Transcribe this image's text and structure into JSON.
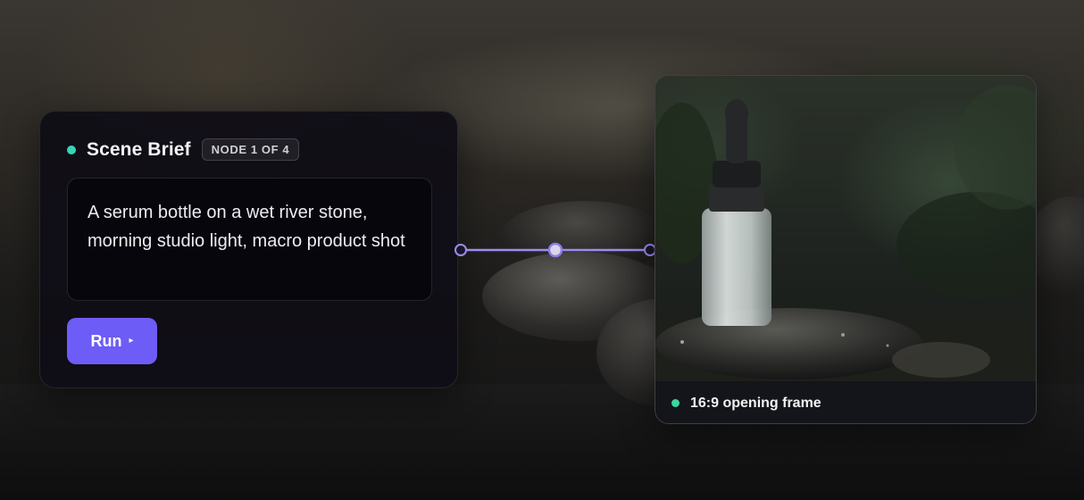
{
  "scene_brief": {
    "title": "Scene Brief",
    "badge": "NODE 1 OF 4",
    "prompt": "A serum bottle on a wet river stone, morning studio light, macro product shot",
    "run_label": "Run",
    "run_icon": "▸",
    "status_dot_color": "#35d6b8",
    "accent_color": "#6d5cf6"
  },
  "output_card": {
    "caption": "16:9 opening frame",
    "status_dot_color": "#3ad79a",
    "image_subject": "serum dropper bottle on wet mossy river stone"
  }
}
